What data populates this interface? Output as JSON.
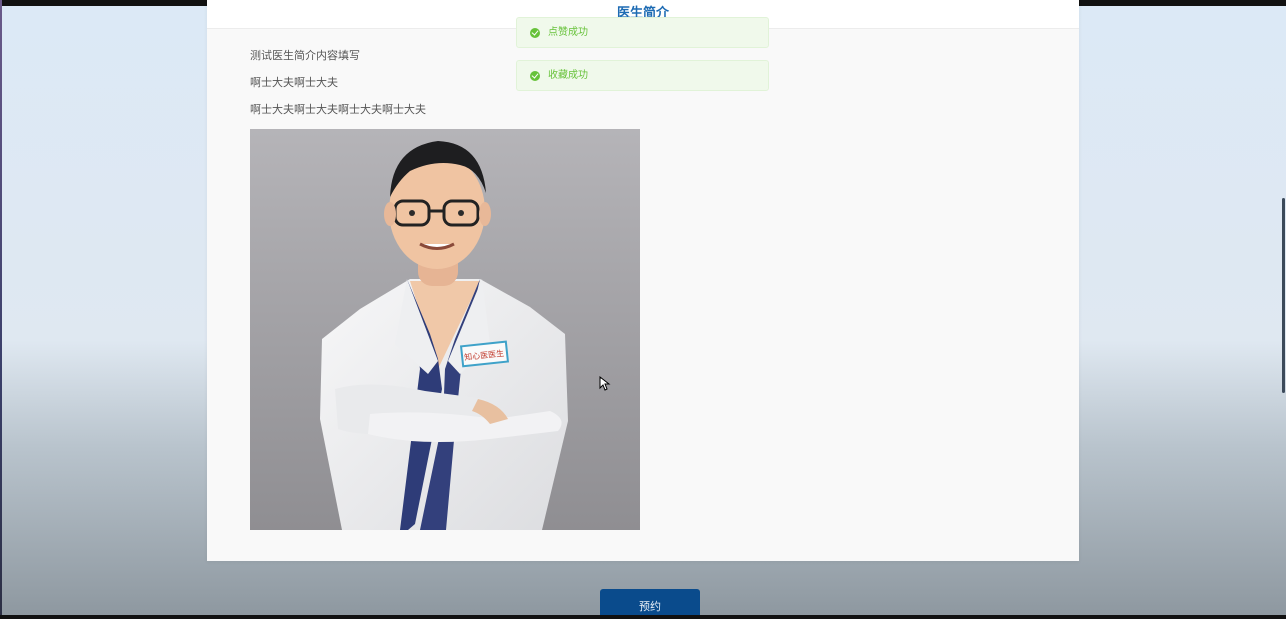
{
  "card": {
    "title": "医生简介"
  },
  "intro": {
    "lines": [
      "测试医生简介内容填写",
      "啊士大夫啊士大夫",
      "啊士大夫啊士大夫啊士大夫啊士大夫"
    ]
  },
  "photo": {
    "badge_text": "知心医医生"
  },
  "toasts": [
    {
      "text": "点赞成功",
      "icon": "check-circle-icon"
    },
    {
      "text": "收藏成功",
      "icon": "check-circle-icon"
    }
  ],
  "actions": {
    "book_label": "预约"
  },
  "colors": {
    "accent": "#1d6bb3",
    "button": "#0a4b8c",
    "success": "#67c23a",
    "success_bg": "#f0f9eb"
  }
}
